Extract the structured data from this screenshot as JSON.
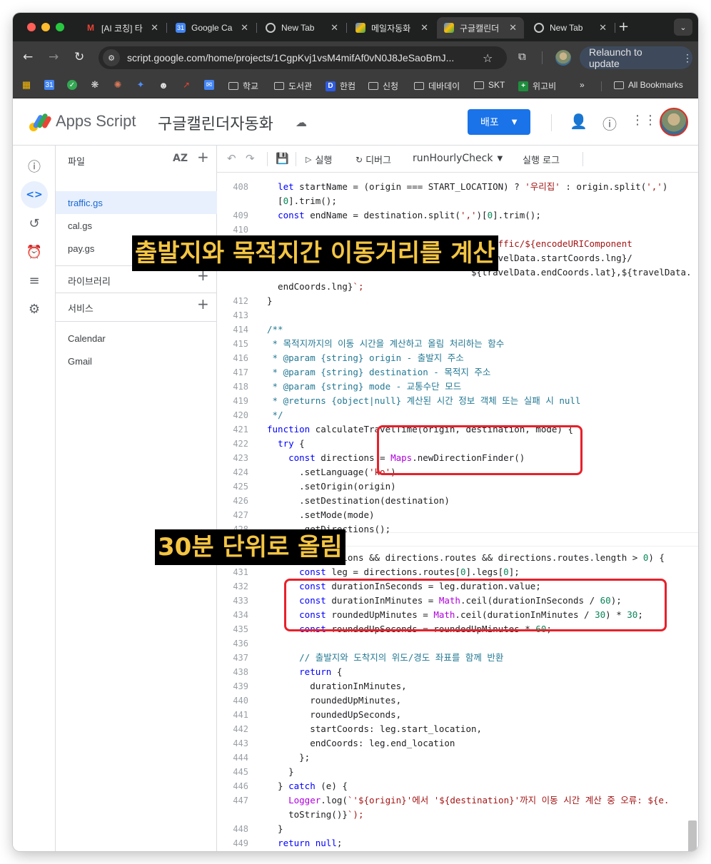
{
  "browser": {
    "tabs": [
      {
        "title": "[AI 코칭] 타",
        "favicon": "gmail-icon",
        "color": "#ea4335"
      },
      {
        "title": "Google Ca",
        "favicon": "calendar-icon",
        "color": "#4285f4"
      },
      {
        "title": "New Tab",
        "favicon": "chrome-icon",
        "color": "#5f6368"
      },
      {
        "title": "메일자동화",
        "favicon": "apps-script-icon",
        "color": "#fbbc04"
      },
      {
        "title": "구글캘린더",
        "favicon": "apps-script-icon",
        "color": "#fbbc04"
      },
      {
        "title": "New Tab",
        "favicon": "chrome-icon",
        "color": "#5f6368"
      }
    ],
    "active_tab_index": 4,
    "url": "script.google.com/home/projects/1CgpKvj1vsM4mifAf0vN0J8JeSaoBmJ...",
    "relaunch_label": "Relaunch to update",
    "bookmarks": [
      {
        "label": "학교",
        "type": "folder"
      },
      {
        "label": "도서관",
        "type": "folder"
      },
      {
        "label": "한컴",
        "type": "link",
        "icon": "D"
      },
      {
        "label": "신청",
        "type": "folder"
      },
      {
        "label": "데바데이",
        "type": "folder"
      },
      {
        "label": "SKT",
        "type": "folder"
      },
      {
        "label": "위고비",
        "type": "link",
        "icon": "+"
      }
    ],
    "more_bookmarks": "»",
    "all_bookmarks": "All Bookmarks"
  },
  "app": {
    "name": "Apps Script",
    "project_title": "구글캘린더자동화",
    "deploy_label": "배포"
  },
  "files_panel": {
    "files_header": "파일",
    "sort_label": "AZ",
    "files": [
      "traffic.gs",
      "cal.gs",
      "pay.gs"
    ],
    "libraries_header": "라이브러리",
    "services_header": "서비스",
    "services": [
      "Calendar",
      "Gmail"
    ]
  },
  "editor_toolbar": {
    "run_label": "실행",
    "debug_label": "디버그",
    "function_name": "runHourlyCheck",
    "log_label": "실행 로그"
  },
  "code_lines": [
    {
      "n": "408",
      "t": "  let startName = (origin === START_LOCATION) ? '우리집' : origin.split(',')"
    },
    {
      "n": "",
      "t": "  [0].trim();"
    },
    {
      "n": "409",
      "t": "  const endName = destination.split(',')[0].trim();"
    },
    {
      "n": "410",
      "t": ""
    },
    {
      "n": "411",
      "t": "  return `https://map.kakao.com/link/by/traffic/${encodeURIComponent"
    },
    {
      "n": "",
      "t": "                                      ${travelData.startCoords.lng}/"
    },
    {
      "n": "",
      "t": "                                      ${travelData.endCoords.lat},${travelData."
    },
    {
      "n": "",
      "t": "  endCoords.lng}`;"
    },
    {
      "n": "412",
      "t": "}"
    },
    {
      "n": "413",
      "t": ""
    },
    {
      "n": "414",
      "t": "/**"
    },
    {
      "n": "415",
      "t": " * 목적지까지의 이동 시간을 계산하고 올림 처리하는 함수"
    },
    {
      "n": "416",
      "t": " * @param {string} origin - 출발지 주소"
    },
    {
      "n": "417",
      "t": " * @param {string} destination - 목적지 주소"
    },
    {
      "n": "418",
      "t": " * @param {string} mode - 교통수단 모드"
    },
    {
      "n": "419",
      "t": " * @returns {object|null} 계산된 시간 정보 객체 또는 실패 시 null"
    },
    {
      "n": "420",
      "t": " */"
    },
    {
      "n": "421",
      "t": "function calculateTravelTime(origin, destination, mode) {"
    },
    {
      "n": "422",
      "t": "  try {"
    },
    {
      "n": "423",
      "t": "    const directions = Maps.newDirectionFinder()"
    },
    {
      "n": "424",
      "t": "      .setLanguage('ko')"
    },
    {
      "n": "425",
      "t": "      .setOrigin(origin)"
    },
    {
      "n": "426",
      "t": "      .setDestination(destination)"
    },
    {
      "n": "427",
      "t": "      .setMode(mode)"
    },
    {
      "n": "428",
      "t": "      .getDirections();"
    },
    {
      "n": "429",
      "t": ""
    },
    {
      "n": "430",
      "t": "    if (directions && directions.routes && directions.routes.length > 0) {"
    },
    {
      "n": "431",
      "t": "      const leg = directions.routes[0].legs[0];"
    },
    {
      "n": "432",
      "t": "      const durationInSeconds = leg.duration.value;"
    },
    {
      "n": "433",
      "t": "      const durationInMinutes = Math.ceil(durationInSeconds / 60);"
    },
    {
      "n": "434",
      "t": "      const roundedUpMinutes = Math.ceil(durationInMinutes / 30) * 30;"
    },
    {
      "n": "435",
      "t": "      const roundedUpSeconds = roundedUpMinutes * 60;"
    },
    {
      "n": "436",
      "t": ""
    },
    {
      "n": "437",
      "t": "      // 출발지와 도착지의 위도/경도 좌표를 함께 반환"
    },
    {
      "n": "438",
      "t": "      return {"
    },
    {
      "n": "439",
      "t": "        durationInMinutes,"
    },
    {
      "n": "440",
      "t": "        roundedUpMinutes,"
    },
    {
      "n": "441",
      "t": "        roundedUpSeconds,"
    },
    {
      "n": "442",
      "t": "        startCoords: leg.start_location,"
    },
    {
      "n": "443",
      "t": "        endCoords: leg.end_location"
    },
    {
      "n": "444",
      "t": "      };"
    },
    {
      "n": "445",
      "t": "    }"
    },
    {
      "n": "446",
      "t": "  } catch (e) {"
    },
    {
      "n": "447",
      "t": "    Logger.log(`'${origin}'에서 '${destination}'까지 이동 시간 계산 중 오류: ${e."
    },
    {
      "n": "",
      "t": "    toString()}`);"
    },
    {
      "n": "448",
      "t": "  }"
    },
    {
      "n": "449",
      "t": "  return null;"
    },
    {
      "n": "450",
      "t": "}"
    }
  ],
  "annotations": {
    "caption_1": "출발지와 목적지간 이동거리를 계산",
    "caption_2": "30분 단위로 올림",
    "highlight_color": "#e8202a",
    "caption_color": "#f4c542"
  }
}
